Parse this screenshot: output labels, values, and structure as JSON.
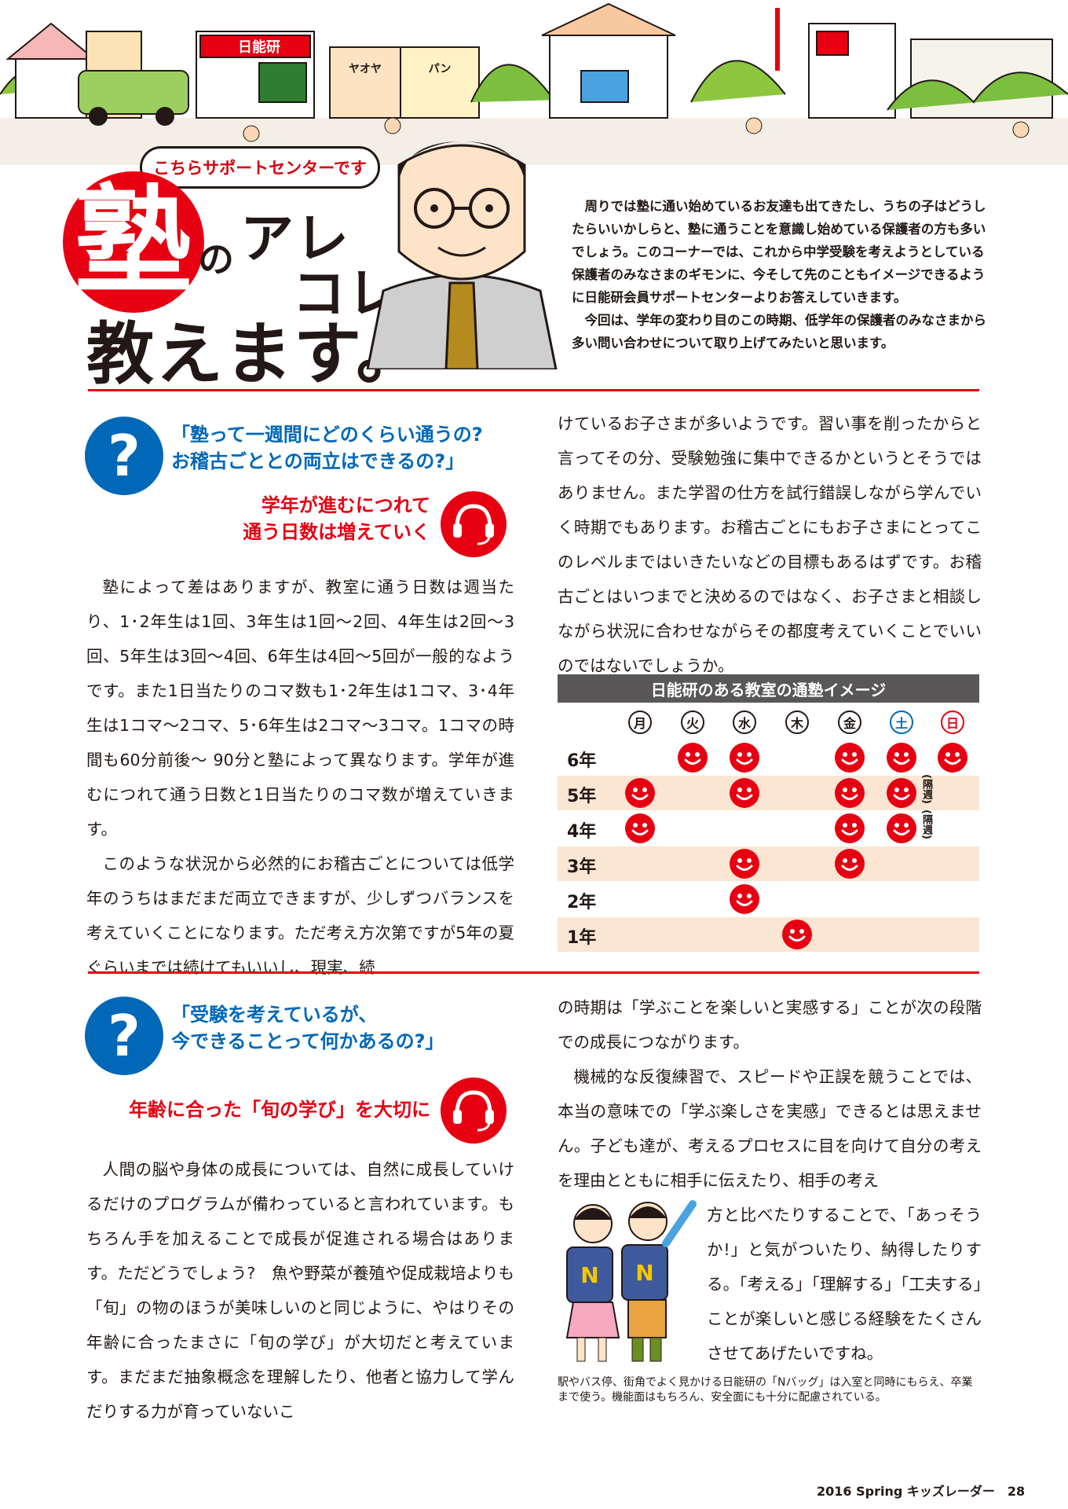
{
  "header": {
    "bubble": "こちらサポートセンターです",
    "title_kanji": "塾",
    "title_no": "の",
    "title_are": "アレ",
    "title_kore": "コレ",
    "title_oshiemasu": "教えます。",
    "intro": [
      "周りでは塾に通い始めているお友達も出てきたし、うちの子はどうしたらいいかしらと、塾に通うことを意識し始めている保護者の方も多いでしょう。このコーナーでは、これから中学受験を考えようとしている保護者のみなさまのギモンに、今そして先のこともイメージできるように日能研会員サポートセンターよりお答えしていきます。",
      "今回は、学年の変わり目のこの時期、低学年の保護者のみなさまから多い問い合わせについて取り上げてみたいと思います。"
    ],
    "illustration_signs": [
      "日能研",
      "ヤオヤ",
      "パン"
    ]
  },
  "section1": {
    "question": [
      "「塾って一週間にどのくらい通うの?",
      "お稽古ごととの両立はできるの?」"
    ],
    "answer": [
      "学年が進むにつれて",
      "通う日数は増えていく"
    ],
    "left": [
      "塾によって差はありますが、教室に通う日数は週当たり、1･2年生は1回、3年生は1回～2回、4年生は2回～3回、5年生は3回～4回、6年生は4回～5回が一般的なようです。また1日当たりのコマ数も1･2年生は1コマ、3･4年生は1コマ～2コマ、5･6年生は2コマ～3コマ。1コマの時間も60分前後～ 90分と塾によって異なります。学年が進むにつれて通う日数と1日当たりのコマ数が増えていきます。",
      "このような状況から必然的にお稽古ごとについては低学年のうちはまだまだ両立できますが、少しずつバランスを考えていくことになります。ただ考え方次第ですが5年の夏ぐらいまでは続けてもいいし、現実、続"
    ],
    "right": "けているお子さまが多いようです。習い事を削ったからと言ってその分、受験勉強に集中できるかというとそうではありません。また学習の仕方を試行錯誤しながら学んでいく時期でもあります。お稽古ごとにもお子さまにとってこのレベルまではいきたいなどの目標もあるはずです。お稽古ごとはいつまでと決めるのではなく、お子さまと相談しながら状況に合わせながらその都度考えていくことでいいのではないでしょうか。"
  },
  "chart_data": {
    "type": "table",
    "title": "日能研のある教室の通塾イメージ",
    "columns": [
      "月",
      "火",
      "水",
      "木",
      "金",
      "土",
      "日"
    ],
    "column_colors": [
      "#231815",
      "#231815",
      "#231815",
      "#231815",
      "#231815",
      "#0068b7",
      "#e60012"
    ],
    "rows": [
      {
        "label": "6年",
        "days": [
          0,
          1,
          1,
          0,
          1,
          1,
          1
        ],
        "note": ""
      },
      {
        "label": "5年",
        "days": [
          1,
          0,
          1,
          0,
          1,
          1,
          0
        ],
        "note": "(隔週)"
      },
      {
        "label": "4年",
        "days": [
          1,
          0,
          0,
          0,
          1,
          1,
          0
        ],
        "note": "(隔週)"
      },
      {
        "label": "3年",
        "days": [
          0,
          0,
          1,
          0,
          1,
          0,
          0
        ],
        "note": ""
      },
      {
        "label": "2年",
        "days": [
          0,
          0,
          1,
          0,
          0,
          0,
          0
        ],
        "note": ""
      },
      {
        "label": "1年",
        "days": [
          0,
          0,
          0,
          1,
          0,
          0,
          0
        ],
        "note": ""
      }
    ]
  },
  "section2": {
    "question": [
      "「受験を考えているが、",
      "今できることって何かあるの?」"
    ],
    "answer": "年齢に合った「旬の学び」を大切に",
    "left": "人間の脳や身体の成長については、自然に成長していけるだけのプログラムが備わっていると言われています。もちろん手を加えることで成長が促進される場合はあります。ただどうでしょう?　魚や野菜が養殖や促成栽培よりも「旬」の物のほうが美味しいのと同じように、やはりその年齢に合ったまさに「旬の学び」が大切だと考えています。まだまだ抽象概念を理解したり、他者と協力して学んだりする力が育っていないこ",
    "right_top": [
      "の時期は「学ぶことを楽しいと実感する」ことが次の段階での成長につながります。",
      "機械的な反復練習で、スピードや正誤を競うことでは、本当の意味での「学ぶ楽しさを実感」できるとは思えません。子ども達が、考えるプロセスに目を向けて自分の考えを理由とともに相手に伝えたり、相手の考え"
    ],
    "right_bottom": "方と比べたりすることで、「あっそうか!」と気がついたり、納得したりする。「考える」「理解する」「工夫する」ことが楽しいと感じる経験をたくさんさせてあげたいですね。",
    "bag_letter": "N",
    "caption": "駅やバス停、街角でよく見かける日能研の「Nバッグ」は入室と同時にもらえ、卒業まで使う。機能面はもちろん、安全面にも十分に配慮されている。"
  },
  "footer": "2016 Spring キッズレーダー　28"
}
